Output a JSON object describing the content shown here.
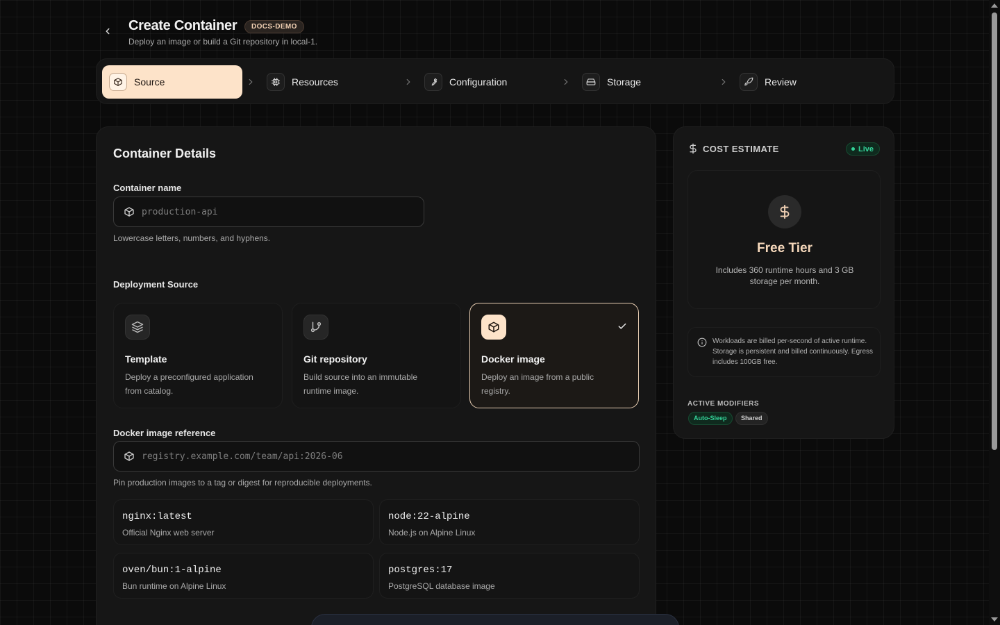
{
  "header": {
    "title": "Create Container",
    "badge": "DOCS-DEMO",
    "subtitle": "Deploy an image or build a Git repository in local-1."
  },
  "stepper": {
    "steps": [
      {
        "label": "Source",
        "icon": "box-icon",
        "active": true
      },
      {
        "label": "Resources",
        "icon": "cpu-icon",
        "active": false
      },
      {
        "label": "Configuration",
        "icon": "wrench-icon",
        "active": false
      },
      {
        "label": "Storage",
        "icon": "hard-drive-icon",
        "active": false
      },
      {
        "label": "Review",
        "icon": "rocket-icon",
        "active": false
      }
    ]
  },
  "details": {
    "heading": "Container Details",
    "name_label": "Container name",
    "name_placeholder": "production-api",
    "name_help": "Lowercase letters, numbers, and hyphens.",
    "source_label": "Deployment Source",
    "sources": [
      {
        "title": "Template",
        "desc": "Deploy a preconfigured application from catalog.",
        "icon": "layers-icon",
        "selected": false
      },
      {
        "title": "Git repository",
        "desc": "Build source into an immutable runtime image.",
        "icon": "git-branch-icon",
        "selected": false
      },
      {
        "title": "Docker image",
        "desc": "Deploy an image from a public registry.",
        "icon": "box-icon",
        "selected": true
      }
    ],
    "image_label": "Docker image reference",
    "image_placeholder": "registry.example.com/team/api:2026-06",
    "image_help": "Pin production images to a tag or digest for reproducible deployments.",
    "suggestions": [
      {
        "name": "nginx:latest",
        "desc": "Official Nginx web server"
      },
      {
        "name": "node:22-alpine",
        "desc": "Node.js on Alpine Linux"
      },
      {
        "name": "oven/bun:1-alpine",
        "desc": "Bun runtime on Alpine Linux"
      },
      {
        "name": "postgres:17",
        "desc": "PostgreSQL database image"
      }
    ]
  },
  "cost": {
    "title": "COST ESTIMATE",
    "live": "Live",
    "tier_name": "Free Tier",
    "tier_desc": "Includes 360 runtime hours and 3 GB storage per month.",
    "note": "Workloads are billed per-second of active runtime. Storage is persistent and billed continuously. Egress includes 100GB free.",
    "modifiers_title": "ACTIVE MODIFIERS",
    "modifiers": [
      "Auto-Sleep",
      "Shared"
    ]
  },
  "colors": {
    "accent": "#fde3c9",
    "live_green": "#34d399",
    "background": "#0b0b0b"
  }
}
